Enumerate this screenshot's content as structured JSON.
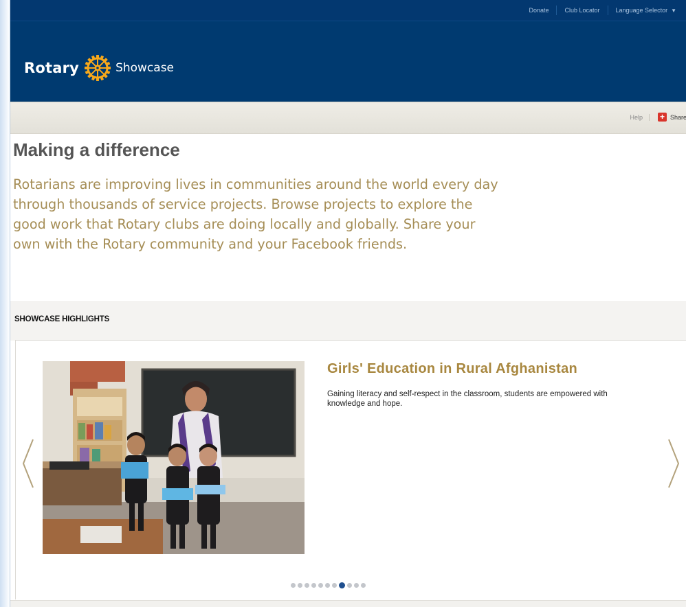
{
  "utility_nav": {
    "links": [
      "Donate",
      "Club Locator",
      "Language Selector"
    ]
  },
  "header": {
    "logo_word": "Rotary",
    "logo_subtitle": "Showcase"
  },
  "toolbar": {
    "help_label": "Help",
    "share_label": "Share",
    "share_icon": "plus-icon"
  },
  "intro": {
    "title": "Making a difference",
    "body": "Rotarians are improving lives in communities around the world every day through thousands of service projects. Browse projects to explore the good work that Rotary clubs are doing locally and globally. Share your own with the Rotary community and your Facebook friends."
  },
  "highlights": {
    "label": "SHOWCASE HIGHLIGHTS",
    "slide": {
      "title": "Girls' Education in Rural Afghanistan",
      "description": "Gaining literacy and self-respect in the classroom, students are empowered with knowledge and hope."
    },
    "total_slides": 11,
    "active_slide_index": 7
  },
  "colors": {
    "brand_navy": "#003a70",
    "rotary_gold": "#f7a81b",
    "accent_text_gold": "#a58d55"
  }
}
